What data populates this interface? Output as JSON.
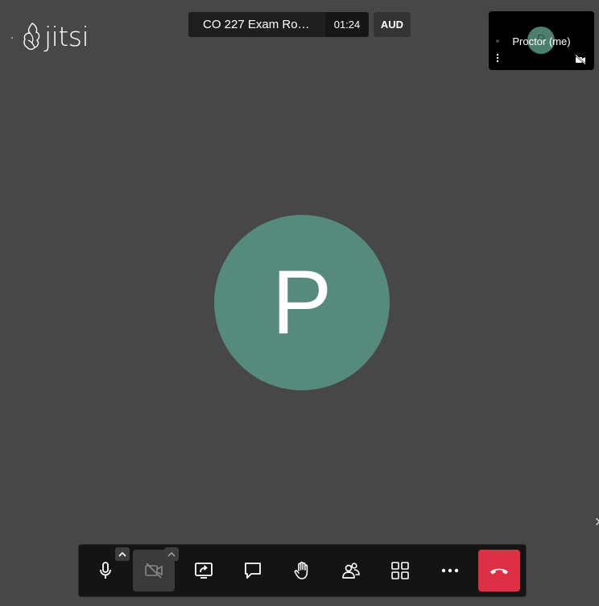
{
  "logo": {
    "text": "jitsi"
  },
  "header": {
    "meeting_title": "CO 227 Exam Ro…",
    "timer": "01:24",
    "audio_only_badge": "AUD"
  },
  "self_view": {
    "initial": "P",
    "name": "Proctor (me)"
  },
  "main_avatar": {
    "initial": "P",
    "color": "#568a7c"
  },
  "toolbar": {
    "buttons": [
      {
        "name": "microphone",
        "icon": "microphone-icon"
      },
      {
        "name": "camera",
        "icon": "camera-off-icon"
      },
      {
        "name": "share-screen",
        "icon": "share-screen-icon"
      },
      {
        "name": "chat",
        "icon": "chat-icon"
      },
      {
        "name": "raise-hand",
        "icon": "raise-hand-icon"
      },
      {
        "name": "participants",
        "icon": "participants-icon"
      },
      {
        "name": "tile-view",
        "icon": "tile-view-icon"
      },
      {
        "name": "more",
        "icon": "more-icon"
      },
      {
        "name": "hangup",
        "icon": "hangup-icon"
      }
    ],
    "hangup_color": "#dd3046"
  },
  "colors": {
    "background": "#474747",
    "toolbar": "#141414"
  }
}
